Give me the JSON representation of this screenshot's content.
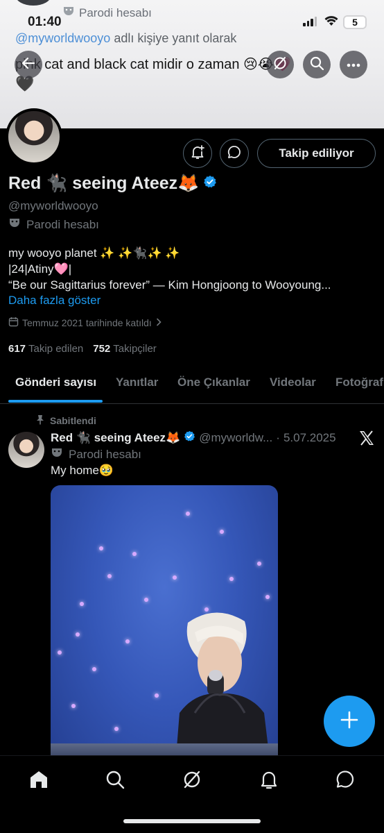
{
  "status_bar": {
    "time": "01:40",
    "battery": "5"
  },
  "banner": {
    "parody_label": "Parodi hesabı",
    "reply_handle": "@myworldwooyo",
    "reply_suffix": "adlı kişiye yanıt olarak",
    "reply_text": "pink cat and black cat midir o zaman 😢😭💗",
    "heart": "🖤"
  },
  "toolbar": {
    "back": "back",
    "grok": "grok",
    "search": "search",
    "more": "more"
  },
  "profile": {
    "display_name": "Red 🐈‍⬛ seeing Ateez🦊",
    "username": "@myworldwooyo",
    "parody_label": "Parodi hesabı",
    "bio_lines": [
      "my wooyo planet ✨ ✨🐈‍⬛✨ ✨",
      "|24|Atiny🩷|",
      "“Be our Sagittarius forever” — Kim Hongjoong to Wooyoung..."
    ],
    "show_more": "Daha fazla göster",
    "joined": "Temmuz 2021 tarihinde katıldı",
    "following_count": "617",
    "following_label": "Takip edilen",
    "followers_count": "752",
    "followers_label": "Takipçiler",
    "follow_button": "Takip ediliyor"
  },
  "tabs": [
    {
      "label": "Gönderi sayısı",
      "active": true
    },
    {
      "label": "Yanıtlar",
      "active": false
    },
    {
      "label": "Öne Çıkanlar",
      "active": false
    },
    {
      "label": "Videolar",
      "active": false
    },
    {
      "label": "Fotoğraflar",
      "active": false
    }
  ],
  "pinned_post": {
    "pinned_label": "Sabitlendi",
    "author_name": "Red 🐈‍⬛ seeing Ateez🦊",
    "author_handle": "@myworldw...",
    "separator": "·",
    "date": "5.07.2025",
    "parody_label": "Parodi hesabı",
    "text": "My home🥹"
  },
  "icons": {
    "verified": "verified-badge-icon",
    "parody": "parody-mask-icon",
    "calendar": "calendar-icon",
    "pin": "pin-icon",
    "x_logo": "x-logo-icon"
  },
  "colors": {
    "accent": "#1d9bf0",
    "background": "#000000",
    "muted_text": "#71767b"
  },
  "fab": {
    "label": "+"
  },
  "bottom_nav": [
    "home",
    "search",
    "grok",
    "notifications",
    "messages"
  ]
}
